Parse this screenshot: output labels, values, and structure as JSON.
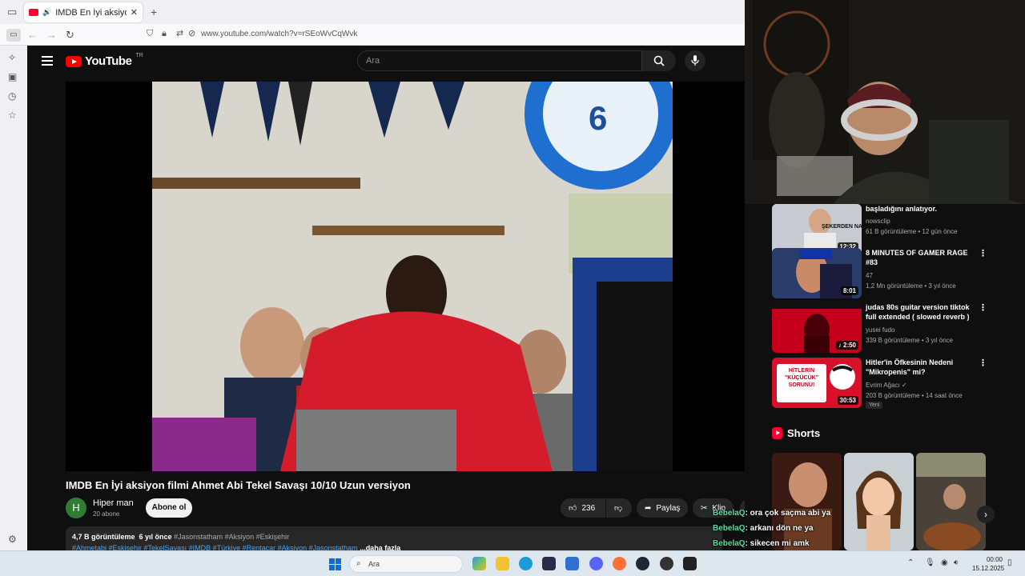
{
  "browser": {
    "tab_title": "IMDB En İyi aksiyon filmi A",
    "tab_close": "✕",
    "new_tab": "+",
    "url": "www.youtube.com/watch?v=rSEoWvCqWvk"
  },
  "youtube": {
    "logo_text": "YouTube",
    "region": "TR",
    "search_placeholder": "Ara",
    "video": {
      "title": "IMDB En İyi aksiyon filmi Ahmet Abi Tekel Savaşı 10/10 Uzun versiyon",
      "channel": "Hiper man",
      "channel_initial": "H",
      "subscribers": "20 abone",
      "subscribe_label": "Abone ol",
      "likes": "236",
      "share_label": "Paylaş",
      "clip_label": "Klip",
      "more_label": "···",
      "views": "4,7 B görüntüleme",
      "age": "6 yıl önce",
      "hashtags_line1": "#Jasonstatham #Aksiyon #Eskişehir",
      "hashtags_line2": "#Ahmetabi #Eskişehir #TekelSavaşı #IMDB #Türkiye #Rentacar #Aksiyon #Jasonstatham",
      "more_link": "...daha fazla"
    },
    "recommendations": [
      {
        "title": "başladığını anlatıyor.",
        "channel": "nowsclip",
        "meta": "61 B görüntüleme • 12 gün önce",
        "duration": "12:32"
      },
      {
        "title": "8 MINUTES OF GAMER RAGE #83",
        "channel": "47",
        "meta": "1,2 Mn görüntüleme • 3 yıl önce",
        "duration": "8:01"
      },
      {
        "title": "judas 80s guitar version tiktok full extended ( slowed reverb )",
        "channel": "yusei fudo",
        "meta": "339 B görüntüleme • 3 yıl önce",
        "duration": "♪ 2:50"
      },
      {
        "title": "Hitler'in Öfkesinin Nedeni \"Mikropenis\" mi?",
        "channel": "Evrim Ağacı ✓",
        "meta": "203 B görüntüleme • 14 saat önce",
        "duration": "30:53",
        "badge": "Yeni"
      }
    ],
    "shorts_heading": "Shorts",
    "thumb_texts": {
      "hitler": "HİTLERİN \"KÜÇÜCÜK\" SORUNU!",
      "sugar": "ŞEKERDEN NASIL ÖL"
    }
  },
  "chat": [
    {
      "user": "BebelaQ",
      "text": ": ora çok saçma abi ya"
    },
    {
      "user": "BebelaQ",
      "text": ": arkanı dön ne ya"
    },
    {
      "user": "BebelaQ",
      "text": ": sikecen mi amk"
    }
  ],
  "taskbar": {
    "search_label": "Ara",
    "time": "00:00",
    "date": "15.12.2025"
  },
  "colors": {
    "yt_red": "#ff0000",
    "yt_bg": "#0f0f0f",
    "chat_user": "#59e0a0",
    "link_blue": "#3ea6ff"
  }
}
